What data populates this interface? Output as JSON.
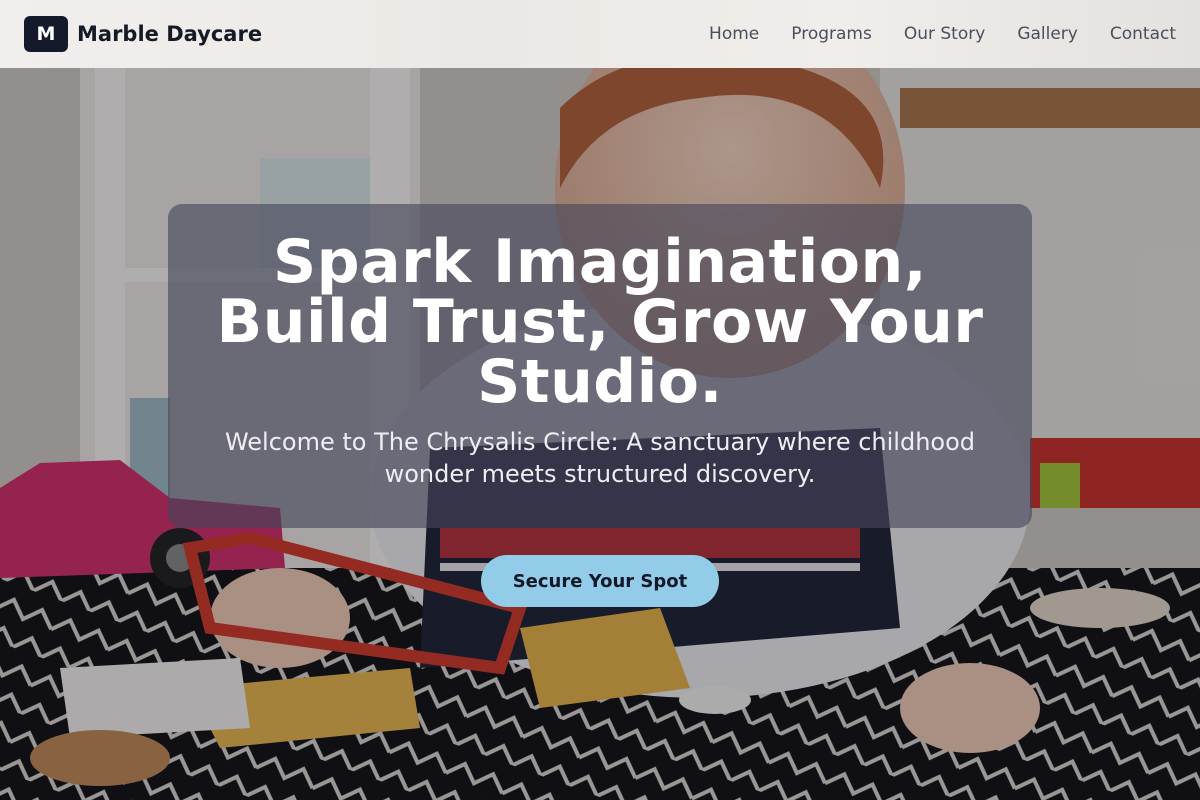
{
  "brand": {
    "mark": "M",
    "name": "Marble Daycare"
  },
  "nav": {
    "items": [
      "Home",
      "Programs",
      "Our Story",
      "Gallery",
      "Contact"
    ]
  },
  "hero": {
    "title": "Spark Imagination, Build Trust, Grow Your Studio.",
    "subtitle": "Welcome to The Chrysalis Circle: A sanctuary where childhood wonder meets structured discovery.",
    "cta_label": "Secure Your Spot",
    "background_image": "child-playing-with-toys-photo"
  },
  "colors": {
    "brand_mark_bg": "#141a2b",
    "cta_bg": "#93cce9",
    "cta_text": "#111827",
    "header_bg": "#efece9",
    "nav_text": "#4a4f5c"
  }
}
